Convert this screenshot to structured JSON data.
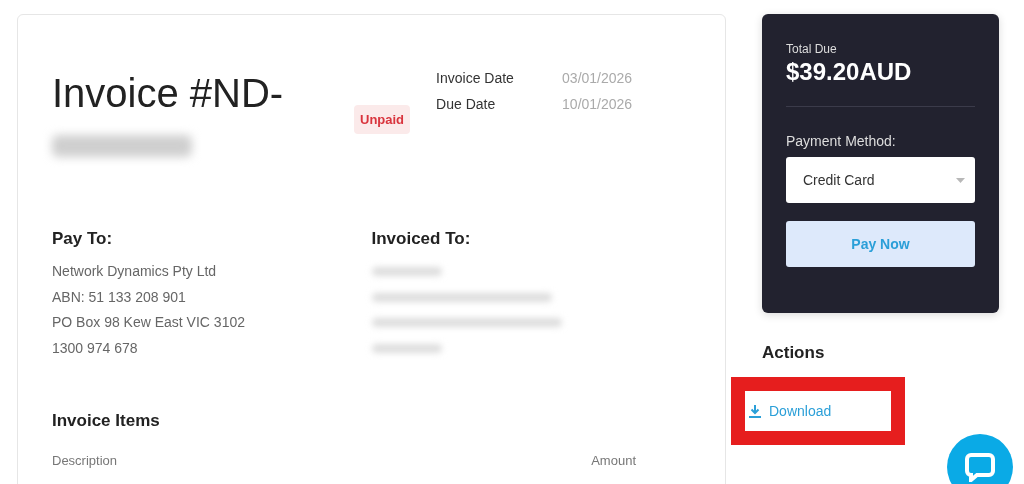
{
  "invoice": {
    "title": "Invoice #ND-",
    "number_redacted": true,
    "status": {
      "label": "Unpaid",
      "kind": "unpaid"
    },
    "dates": [
      {
        "label": "Invoice Date",
        "value": "03/01/2026"
      },
      {
        "label": "Due Date",
        "value": "10/01/2026"
      }
    ],
    "pay_to": {
      "heading": "Pay To:",
      "lines": [
        "Network Dynamics Pty Ltd",
        "ABN: 51 133 208 901",
        "PO Box 98 Kew East VIC 3102",
        "1300 974 678"
      ]
    },
    "invoiced_to": {
      "heading": "Invoiced To:",
      "redacted_lines": [
        {
          "redacted": true
        },
        {
          "redacted": true
        },
        {
          "redacted": true
        },
        {
          "redacted": true
        }
      ]
    },
    "items": {
      "heading": "Invoice Items",
      "columns": [
        "Description",
        "Amount"
      ]
    }
  },
  "payment": {
    "total_label": "Total Due",
    "total": "$39.20AUD",
    "method_label": "Payment Method:",
    "method_value": "Credit Card",
    "pay_button": "Pay Now"
  },
  "actions": {
    "heading": "Actions",
    "items": [
      {
        "label": "Download",
        "highlighted": true
      }
    ]
  }
}
